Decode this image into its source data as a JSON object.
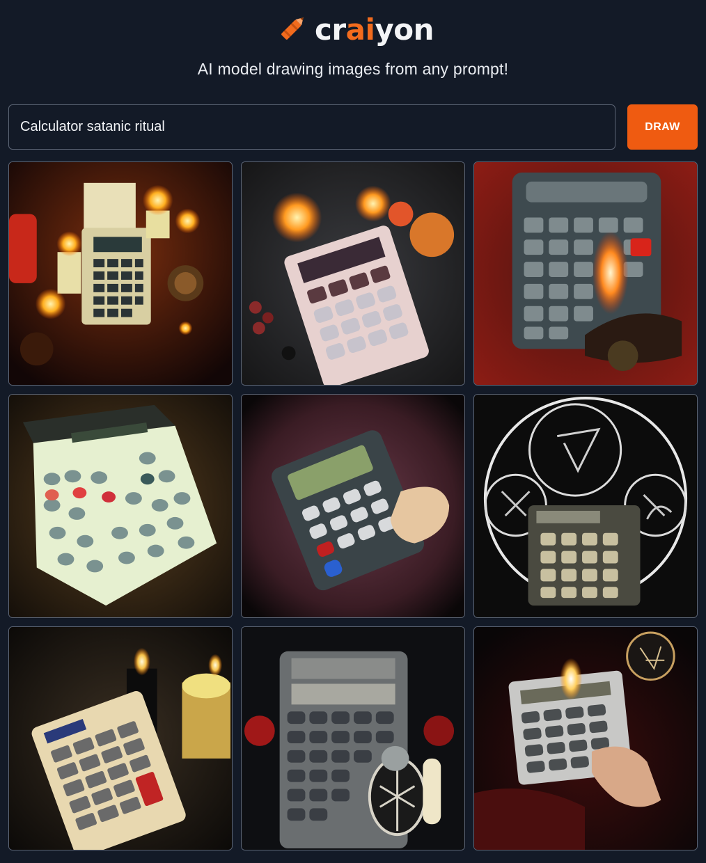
{
  "brand": {
    "name_pre": "cr",
    "name_ai": "ai",
    "name_post": "yon",
    "logo_icon": "crayon-icon",
    "accent_color": "#f26b1d"
  },
  "tagline": "AI model drawing images from any prompt!",
  "prompt": {
    "value": "Calculator satanic ritual"
  },
  "draw_button": {
    "label": "DRAW",
    "color": "#ef5b11"
  },
  "results": {
    "count": 9,
    "tile_subjects": [
      "calculator-with-candles",
      "pink-calculator-on-dark-cloth",
      "calculator-with-flame-on-red",
      "white-calculator-green-glow",
      "hand-holding-calculator",
      "calculator-in-occult-circle",
      "calculator-with-black-candles",
      "grey-calculator-with-sigil",
      "hand-on-calculator-with-candle"
    ]
  }
}
